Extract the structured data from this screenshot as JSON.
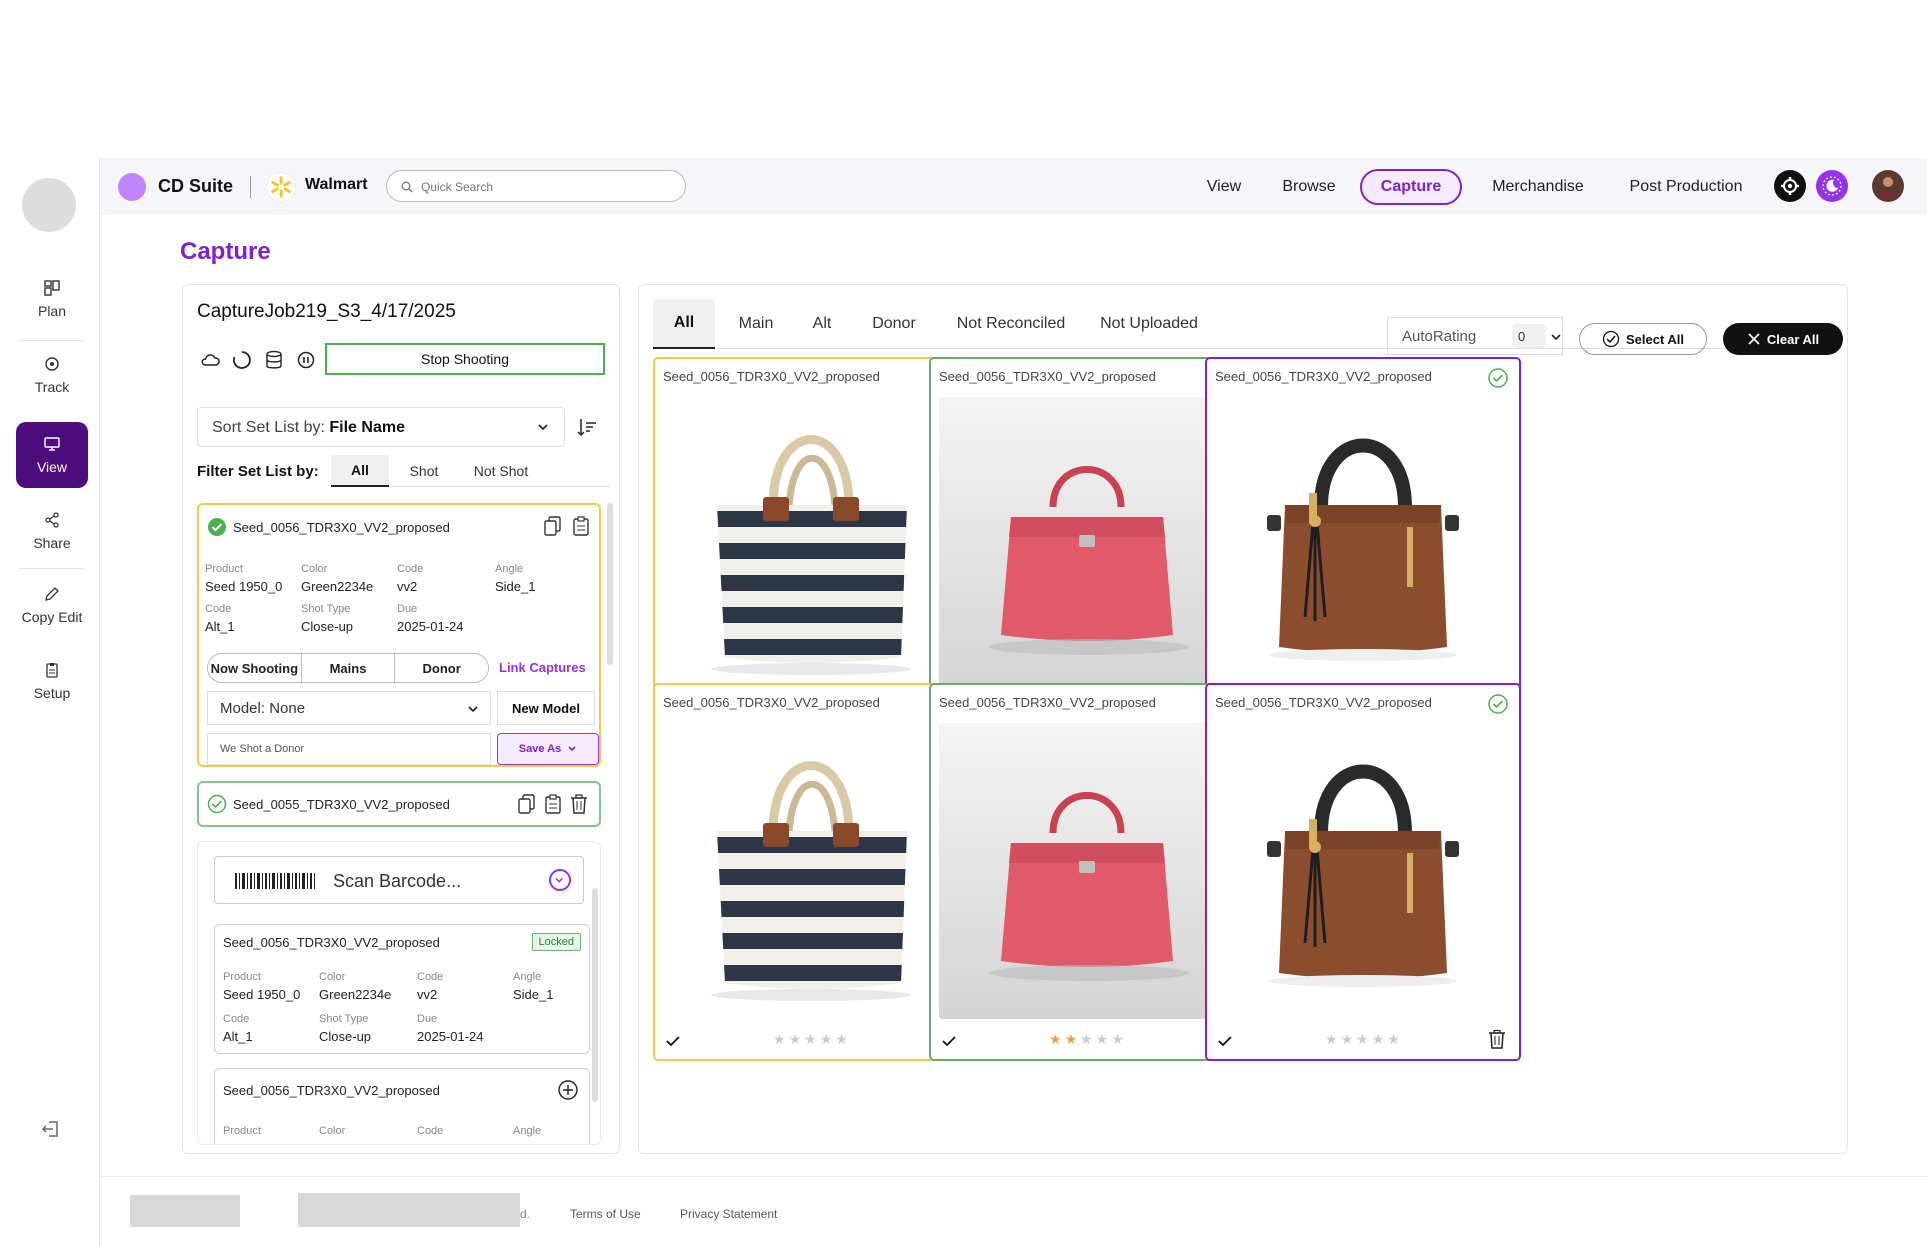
{
  "sidebar": {
    "items": [
      {
        "label": "Plan",
        "icon": "layout-icon"
      },
      {
        "label": "Track",
        "icon": "target-icon"
      },
      {
        "label": "View",
        "icon": "monitor-icon"
      },
      {
        "label": "Share",
        "icon": "share-icon"
      },
      {
        "label": "Copy Edit",
        "icon": "pencil-icon"
      },
      {
        "label": "Setup",
        "icon": "clipboard-icon"
      }
    ],
    "active": "View"
  },
  "topbar": {
    "app_name": "CD Suite",
    "client": "Walmart",
    "search_placeholder": "Quick Search",
    "nav": [
      "View",
      "Browse",
      "Capture",
      "Merchandise",
      "Post Production"
    ],
    "active_nav": "Capture"
  },
  "page": {
    "title": "Capture"
  },
  "job": {
    "title": "CaptureJob219_S3_4/17/2025",
    "stop_label": "Stop Shooting",
    "sort_prefix": "Sort Set List by:",
    "sort_value": "File Name",
    "filter_label": "Filter Set List by:",
    "filter_tabs": [
      "All",
      "Shot",
      "Not Shot"
    ],
    "filter_active": "All"
  },
  "selected_set": {
    "name": "Seed_0056_TDR3X0_VV2_proposed",
    "fields": [
      {
        "label": "Product",
        "value": "Seed 1950_0"
      },
      {
        "label": "Color",
        "value": "Green2234e"
      },
      {
        "label": "Code",
        "value": "vv2"
      },
      {
        "label": "Angle",
        "value": "Side_1"
      },
      {
        "label": "Code",
        "value": "Alt_1"
      },
      {
        "label": "Shot Type",
        "value": "Close-up"
      },
      {
        "label": "Due",
        "value": "2025-01-24"
      }
    ],
    "segments": [
      "Now Shooting",
      "Mains",
      "Donor"
    ],
    "link_captures": "Link Captures",
    "model_label": "Model:",
    "model_value": "None",
    "new_model": "New Model",
    "donor_text": "We Shot  a Donor",
    "save_as": "Save As"
  },
  "second_set": {
    "name": "Seed_0055_TDR3X0_VV2_proposed"
  },
  "scan": {
    "placeholder": "Scan Barcode...",
    "card1": {
      "name": "Seed_0056_TDR3X0_VV2_proposed",
      "badge": "Locked",
      "fields": [
        {
          "label": "Product",
          "value": "Seed 1950_0"
        },
        {
          "label": "Color",
          "value": "Green2234e"
        },
        {
          "label": "Code",
          "value": "vv2"
        },
        {
          "label": "Angle",
          "value": "Side_1"
        },
        {
          "label": "Code",
          "value": "Alt_1"
        },
        {
          "label": "Shot Type",
          "value": "Close-up"
        },
        {
          "label": "Due",
          "value": "2025-01-24"
        }
      ]
    },
    "card2": {
      "name": "Seed_0056_TDR3X0_VV2_proposed",
      "labels": [
        "Product",
        "Color",
        "Code",
        "Angle"
      ]
    }
  },
  "grid": {
    "tabs": [
      "All",
      "Main",
      "Alt",
      "Donor",
      "Not Reconciled",
      "Not Uploaded"
    ],
    "active_tab": "All",
    "autorating_label": "AutoRating",
    "autorating_value": "0",
    "select_all": "Select All",
    "clear_all": "Clear All",
    "tiles": [
      {
        "name": "Seed_0056_TDR3X0_VV2_proposed",
        "border": "#f2c94c",
        "bag": "striped-tote",
        "rating": 0
      },
      {
        "name": "Seed_0056_TDR3X0_VV2_proposed",
        "border": "#6fa86f",
        "bag": "pink-handbag",
        "rating": 2
      },
      {
        "name": "Seed_0056_TDR3X0_VV2_proposed",
        "border": "#7e22ce",
        "bag": "brown-tote",
        "rating": 0
      },
      {
        "name": "Seed_0056_TDR3X0_VV2_proposed",
        "border": "#f2c94c",
        "bag": "striped-tote",
        "rating": 0
      },
      {
        "name": "Seed_0056_TDR3X0_VV2_proposed",
        "border": "#6fa86f",
        "bag": "pink-handbag",
        "rating": 2
      },
      {
        "name": "Seed_0056_TDR3X0_VV2_proposed",
        "border": "#7e22ce",
        "bag": "brown-tote",
        "rating": 0
      }
    ]
  },
  "footer": {
    "links": [
      "Terms of Use",
      "Privacy Statement"
    ],
    "truncated": "d."
  },
  "colors": {
    "accent": "#7e22ce",
    "selected": "#f2c94c",
    "ok": "#4caf50"
  }
}
